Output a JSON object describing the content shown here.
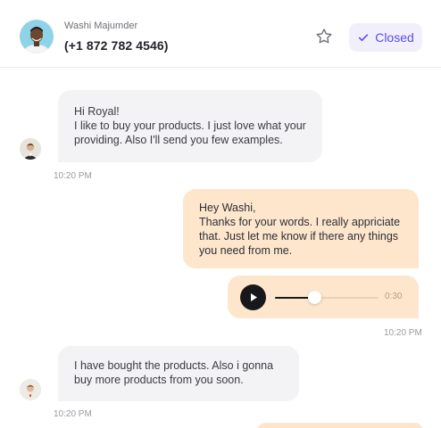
{
  "contact": {
    "name": "Washi Majumder",
    "phone": "(+1 872 782 4546)"
  },
  "header": {
    "status_label": "Closed"
  },
  "messages": [
    {
      "direction": "incoming",
      "lines": [
        "Hi Royal!",
        "I like to buy your products. I just love what your",
        "providing. Also I'll send you few examples."
      ],
      "time": "10:20 PM"
    },
    {
      "direction": "outgoing",
      "lines": [
        "Hey Washi,",
        "Thanks for your words. I really appriciate",
        "that. Just let me know if there any things",
        "you need from me."
      ]
    },
    {
      "direction": "outgoing",
      "type": "audio",
      "duration": "0:30",
      "progress": 0.38,
      "time": "10:20 PM"
    },
    {
      "direction": "incoming",
      "lines": [
        "I have bought the products. Also i gonna",
        "buy more products from you soon."
      ],
      "time": "10:20 PM"
    }
  ],
  "colors": {
    "accent": "#5c4ce8",
    "outgoing_bubble": "#fde6cc",
    "incoming_bubble": "#f3f3f5"
  },
  "icons": {
    "favorite": "star-icon",
    "status": "check-icon",
    "play": "play-icon"
  }
}
